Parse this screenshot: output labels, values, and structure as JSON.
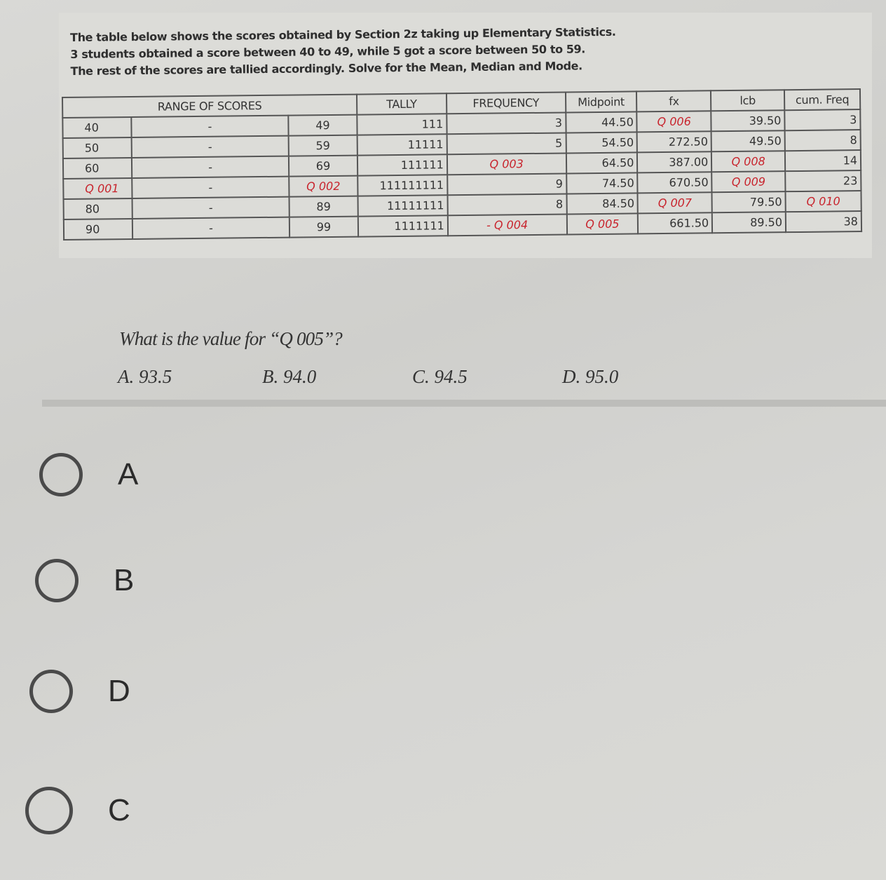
{
  "intro": {
    "lines": [
      "The table below shows the scores obtained by Section 2z taking up Elementary Statistics.",
      "3 students obtained a score between 40 to 49, while 5 got a score between 50 to 59.",
      "The rest of the scores are tallied accordingly.  Solve for the Mean, Median and Mode."
    ]
  },
  "table": {
    "headers": [
      "RANGE OF SCORES",
      "TALLY",
      "FREQUENCY",
      "Midpoint",
      "fx",
      "lcb",
      "cum. Freq"
    ],
    "rows": [
      {
        "lower": "40",
        "dash": "-",
        "upper": "49",
        "tally": "111",
        "frequency": "3",
        "midpoint": "44.50",
        "fx": "Q 006",
        "lcb": "39.50",
        "cum_freq": "3"
      },
      {
        "lower": "50",
        "dash": "-",
        "upper": "59",
        "tally": "11111",
        "frequency": "5",
        "midpoint": "54.50",
        "fx": "272.50",
        "lcb": "49.50",
        "cum_freq": "8"
      },
      {
        "lower": "60",
        "dash": "-",
        "upper": "69",
        "tally": "111111",
        "frequency": "Q 003",
        "midpoint": "64.50",
        "fx": "387.00",
        "lcb": "Q 008",
        "cum_freq": "14"
      },
      {
        "lower": "Q 001",
        "dash": "-",
        "upper": "Q 002",
        "tally": "111111111",
        "frequency": "9",
        "midpoint": "74.50",
        "fx": "670.50",
        "lcb": "Q 009",
        "cum_freq": "23"
      },
      {
        "lower": "80",
        "dash": "-",
        "upper": "89",
        "tally": "11111111",
        "frequency": "8",
        "midpoint": "84.50",
        "fx": "Q 007",
        "lcb": "79.50",
        "cum_freq": "Q 010"
      },
      {
        "lower": "90",
        "dash": "-",
        "upper": "99",
        "tally": "1111111",
        "frequency": "- Q 004",
        "midpoint": "Q 005",
        "fx": "661.50",
        "lcb": "89.50",
        "cum_freq": "38"
      }
    ]
  },
  "question": {
    "text": "What is the value for “Q 005”?",
    "choices": [
      "A.  93.5",
      "B.  94.0",
      "C.  94.5",
      "D.  95.0"
    ]
  },
  "options": [
    {
      "label": "A",
      "selected": false
    },
    {
      "label": "B",
      "selected": false
    },
    {
      "label": "D",
      "selected": false
    },
    {
      "label": "C",
      "selected": false
    }
  ],
  "colors": {
    "placeholder_red": "#c8232c",
    "text": "#333333"
  }
}
